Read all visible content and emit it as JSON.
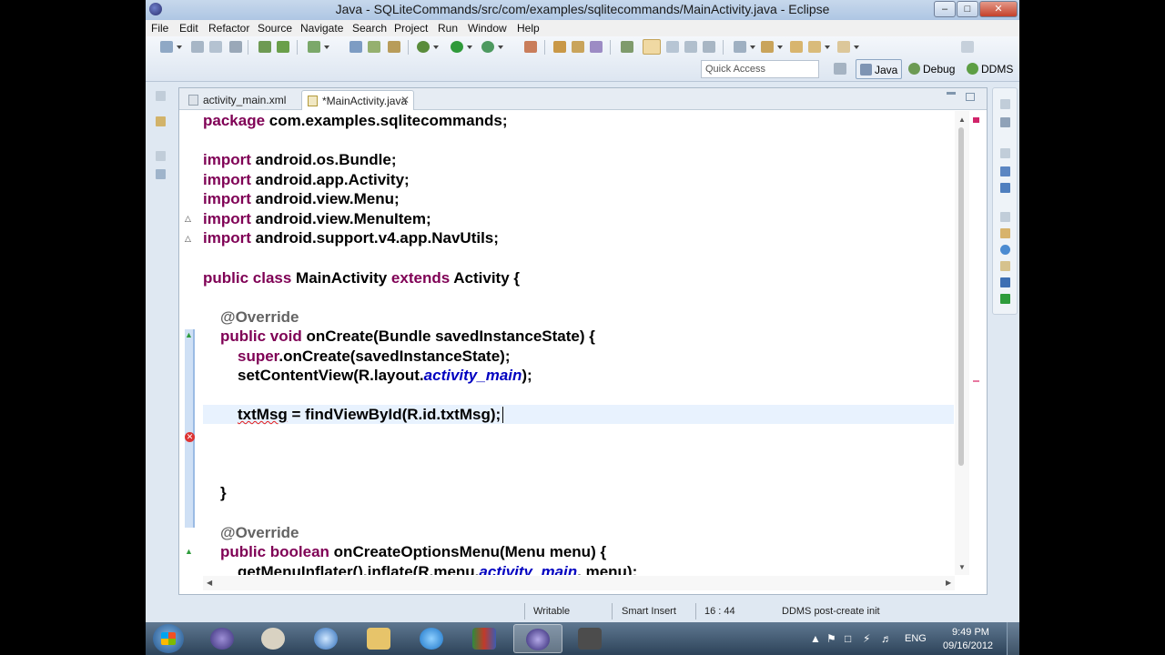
{
  "window": {
    "title": "Java - SQLiteCommands/src/com/examples/sqlitecommands/MainActivity.java - Eclipse"
  },
  "menu": [
    "File",
    "Edit",
    "Refactor",
    "Source",
    "Navigate",
    "Search",
    "Project",
    "Run",
    "Window",
    "Help"
  ],
  "toolbar": {
    "quick_access_placeholder": "Quick Access",
    "perspectives": [
      "Java",
      "Debug",
      "DDMS"
    ]
  },
  "editor": {
    "tabs": [
      {
        "label": "activity_main.xml"
      },
      {
        "label": "*MainActivity.java"
      }
    ],
    "code": {
      "l1": {
        "kw": "package",
        "rest": " com.examples.sqlitecommands;"
      },
      "l3": {
        "kw": "import",
        "rest": " android.os.Bundle;"
      },
      "l4": {
        "kw": "import",
        "rest": " android.app.Activity;"
      },
      "l5": {
        "kw": "import",
        "rest": " android.view.Menu;"
      },
      "l6": {
        "kw": "import",
        "rest": " android.view.MenuItem;"
      },
      "l7": {
        "kw": "import",
        "rest": " android.support.v4.app.NavUtils;"
      },
      "l9": {
        "kw1": "public class",
        "mid": " MainActivity ",
        "kw2": "extends",
        "rest": " Activity {"
      },
      "l11": {
        "ann": "@Override"
      },
      "l12": {
        "kw": "public void",
        "rest": " onCreate(Bundle savedInstanceState) {"
      },
      "l13": {
        "kw": "super",
        "rest": ".onCreate(savedInstanceState);"
      },
      "l14": {
        "pre": "setContentView(R.layout.",
        "it": "activity_main",
        "post": ");"
      },
      "l16": {
        "err": "txtMsg",
        "rest": " = findViewById(R.id.txtMsg);"
      },
      "l20": {
        "text": "}"
      },
      "l22": {
        "ann": "@Override"
      },
      "l23": {
        "kw": "public boolean",
        "rest": " onCreateOptionsMenu(Menu menu) {"
      },
      "l24": {
        "pre": "getMenuInflater().inflate(R.menu.",
        "it": "activity_main",
        "post": ", menu);"
      }
    }
  },
  "status": {
    "mode": "Writable",
    "insert": "Smart Insert",
    "position": "16 : 44",
    "message": "DDMS post-create init"
  },
  "taskbar": {
    "clock_time": "9:49 PM",
    "clock_date": "09/16/2012",
    "language": "ENG"
  }
}
